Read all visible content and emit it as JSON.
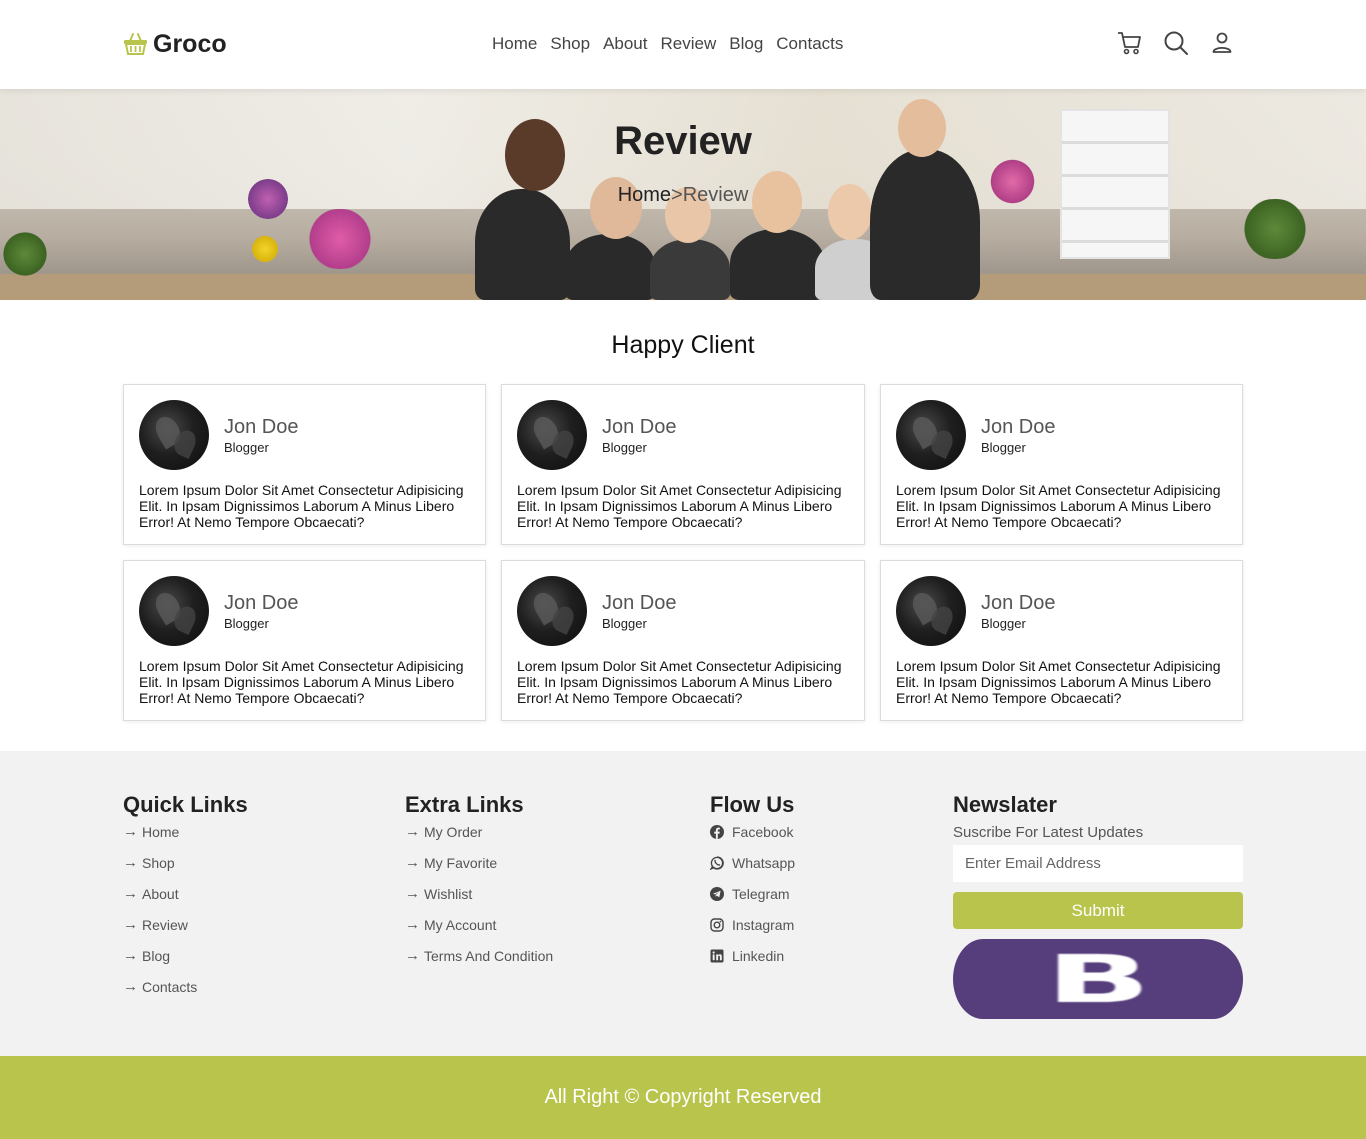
{
  "header": {
    "logo_text": "Groco",
    "nav": [
      "Home",
      "Shop",
      "About",
      "Review",
      "Blog",
      "Contacts"
    ],
    "icons": [
      "cart-icon",
      "search-icon",
      "user-icon"
    ]
  },
  "hero": {
    "title": "Review",
    "breadcrumb": {
      "home": "Home",
      "separator": ">",
      "current": "Review"
    }
  },
  "section": {
    "title": "Happy Client"
  },
  "reviews": [
    {
      "name": "Jon Doe",
      "role": "Blogger",
      "text": "Lorem Ipsum Dolor Sit Amet Consectetur Adipisicing Elit. In Ipsam Dignissimos Laborum A Minus Libero Error! At Nemo Tempore Obcaecati?"
    },
    {
      "name": "Jon Doe",
      "role": "Blogger",
      "text": "Lorem Ipsum Dolor Sit Amet Consectetur Adipisicing Elit. In Ipsam Dignissimos Laborum A Minus Libero Error! At Nemo Tempore Obcaecati?"
    },
    {
      "name": "Jon Doe",
      "role": "Blogger",
      "text": "Lorem Ipsum Dolor Sit Amet Consectetur Adipisicing Elit. In Ipsam Dignissimos Laborum A Minus Libero Error! At Nemo Tempore Obcaecati?"
    },
    {
      "name": "Jon Doe",
      "role": "Blogger",
      "text": "Lorem Ipsum Dolor Sit Amet Consectetur Adipisicing Elit. In Ipsam Dignissimos Laborum A Minus Libero Error! At Nemo Tempore Obcaecati?"
    },
    {
      "name": "Jon Doe",
      "role": "Blogger",
      "text": "Lorem Ipsum Dolor Sit Amet Consectetur Adipisicing Elit. In Ipsam Dignissimos Laborum A Minus Libero Error! At Nemo Tempore Obcaecati?"
    },
    {
      "name": "Jon Doe",
      "role": "Blogger",
      "text": "Lorem Ipsum Dolor Sit Amet Consectetur Adipisicing Elit. In Ipsam Dignissimos Laborum A Minus Libero Error! At Nemo Tempore Obcaecati?"
    }
  ],
  "footer": {
    "quick_links": {
      "title": "Quick Links",
      "items": [
        "Home",
        "Shop",
        "About",
        "Review",
        "Blog",
        "Contacts"
      ]
    },
    "extra_links": {
      "title": "Extra Links",
      "items": [
        "My Order",
        "My Favorite",
        "Wishlist",
        "My Account",
        "Terms And Condition"
      ]
    },
    "follow": {
      "title": "Flow Us",
      "items": [
        {
          "label": "Facebook",
          "icon": "facebook-icon"
        },
        {
          "label": "Whatsapp",
          "icon": "whatsapp-icon"
        },
        {
          "label": "Telegram",
          "icon": "telegram-icon"
        },
        {
          "label": "Instagram",
          "icon": "instagram-icon"
        },
        {
          "label": "Linkedin",
          "icon": "linkedin-icon"
        }
      ]
    },
    "newsletter": {
      "title": "Newslater",
      "subtitle": "Suscribe For Latest Updates",
      "placeholder": "Enter Email Address",
      "submit": "Submit",
      "brand_letter": "B"
    },
    "copyright": "All Right © Copyright Reserved"
  },
  "colors": {
    "accent": "#b8c44b",
    "brand_purple": "#563d7c",
    "footer_bg": "#f2f2f2"
  }
}
